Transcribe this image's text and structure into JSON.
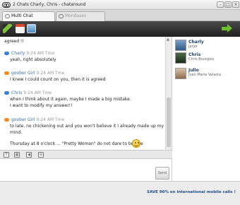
{
  "window": {
    "title": "2 Chats Charly, Chris - chataround",
    "buttons": {
      "minimize": "–",
      "maximize": "□",
      "close": "×"
    }
  },
  "tabs": [
    {
      "label": "Multi Chat",
      "active": true
    },
    {
      "label": "Mondases",
      "active": false
    }
  ],
  "toolbar": {
    "icons": [
      "pencil-icon",
      "calendar-icon",
      "photo-icon",
      "forward-arrow-icon"
    ]
  },
  "messages": [
    {
      "sender": "",
      "time": "",
      "lines": [
        "agreed !!"
      ]
    },
    {
      "sender": "Charly",
      "time": "9:24 AM Tme",
      "bubble_color": "#3a7fd5",
      "lines": [
        "yeah, right absolutely"
      ]
    },
    {
      "sender": "goober Girl",
      "time": "9:24 AM Tme",
      "bubble_color": "#f08a1f",
      "lines": [
        "I knew I could count on you, then it is agreed"
      ]
    },
    {
      "sender": "Chris",
      "time": "9:24 AM Tme",
      "bubble_color": "#3a7fd5",
      "lines": [
        "when I think about it again, maybe I made a big mistake.",
        "I want to modify my answer!!"
      ]
    },
    {
      "sender": "goober Girl",
      "time": "9:24 AM Tme",
      "bubble_color": "#f08a1f",
      "lines": [
        "to late, no chickening out and you won't believe it I already made up my",
        "mind.",
        "Thursday at 8 o'clock ... \"Pretty Woman\" do not dare to be late"
      ]
    }
  ],
  "contacts": [
    {
      "name": "Charly",
      "subtitle": "jarjor"
    },
    {
      "name": "Chris",
      "subtitle": "Chris Bourgois"
    },
    {
      "name": "Julio",
      "subtitle": "Joan Maria Velasta"
    }
  ],
  "format_bar": {
    "icons": [
      "text-format-icon",
      "grid-icon",
      "sound-icon",
      "settings-icon"
    ],
    "glyphs": [
      "T",
      "▦",
      "◀",
      "⊖"
    ]
  },
  "input": {
    "send_label": "Send"
  },
  "footer": {
    "promo": "SAVE 90% on international mobile calls !"
  },
  "colors": {
    "toolbar": "#2a2a2a",
    "contact_name": "#1f3e66",
    "promo": "#1f4f8a"
  }
}
